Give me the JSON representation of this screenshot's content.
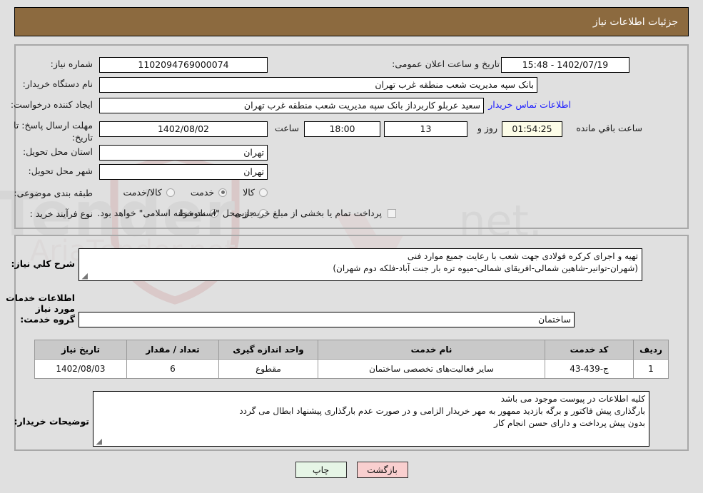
{
  "header": {
    "title": "جزئیات اطلاعات نیاز"
  },
  "form": {
    "need_number": {
      "label": "شماره نیاز:",
      "value": "1102094769000074"
    },
    "public_announce": {
      "label": "تاریخ و ساعت اعلان عمومی:",
      "value": "1402/07/19 - 15:48"
    },
    "buyer_org": {
      "label": "نام دستگاه خریدار:",
      "value": "بانک سپه مدیریت شعب منطقه غرب تهران"
    },
    "requester": {
      "label": "ایجاد کننده درخواست:",
      "value": "سعید عربلو کاربرداز بانک سپه مدیریت شعب منطقه غرب تهران"
    },
    "contact_link": "اطلاعات تماس خریدار",
    "deadline": {
      "label": "مهلت ارسال پاسخ: تا تاریخ:",
      "date": "1402/08/02",
      "time_label": "ساعت",
      "time": "18:00",
      "days": "13",
      "days_suffix": "روز و",
      "timer": "01:54:25",
      "timer_suffix": "ساعت باقي مانده"
    },
    "province": {
      "label": "استان محل تحویل:",
      "value": "تهران"
    },
    "city": {
      "label": "شهر محل تحویل:",
      "value": "تهران"
    },
    "category": {
      "label": "طبقه بندی موضوعی:",
      "options": [
        {
          "text": "کالا",
          "selected": false
        },
        {
          "text": "خدمت",
          "selected": true
        },
        {
          "text": "کالا/خدمت",
          "selected": false
        }
      ]
    },
    "process_type": {
      "label": "نوع فرآیند خرید :",
      "options": [
        {
          "text": "جزیی",
          "selected": false
        },
        {
          "text": "متوسط",
          "selected": true
        }
      ]
    },
    "treasury": {
      "checked": false,
      "text": "پرداخت تمام یا بخشی از مبلغ خرید،از محل \"اسناد خزانه اسلامی\" خواهد بود."
    }
  },
  "need_summary": {
    "label": "شرح کلي نياز:",
    "lines": [
      "تهیه و اجرای کرکره فولادی جهت شعب با رعایت جمیع موارد فنی",
      "(شهران-توانیر-شاهین شمالی-افریقای شمالی-میوه تره بار جنت آباد-فلکه دوم شهران)"
    ]
  },
  "services_section": {
    "heading": "اطلاعات خدمات مورد نیاز",
    "service_group": {
      "label": "گروه خدمت:",
      "value": "ساختمان"
    }
  },
  "table": {
    "columns": [
      "ردیف",
      "کد خدمت",
      "نام خدمت",
      "واحد اندازه گیری",
      "تعداد / مقدار",
      "تاریخ نیاز"
    ],
    "rows": [
      [
        "1",
        "ج-439-43",
        "سایر فعالیت‌های تخصصی ساختمان",
        "مقطوع",
        "6",
        "1402/08/03"
      ]
    ]
  },
  "buyer_notes": {
    "label": "توضیحات خریدار:",
    "lines": [
      "کلیه اطلاعات در پیوست موجود می باشد",
      "بارگذاری پیش فاکتور و برگه بازدید ممهور به مهر خریدار الزامی و در صورت عدم بارگذاری پیشنهاد ابطال می گردد",
      "بدون پیش پرداخت و دارای حسن انجام کار"
    ]
  },
  "buttons": {
    "print": "چاپ",
    "back": "بازگشت"
  },
  "colors": {
    "header_bg": "#8c6a3f",
    "page_bg": "#e0e0e0",
    "link": "#1a1aff",
    "table_header_bg": "#c9c9c9",
    "timer_bg": "#fdfde8",
    "btn_print_bg": "#e6f5e6",
    "btn_back_bg": "#f9cfcf"
  }
}
